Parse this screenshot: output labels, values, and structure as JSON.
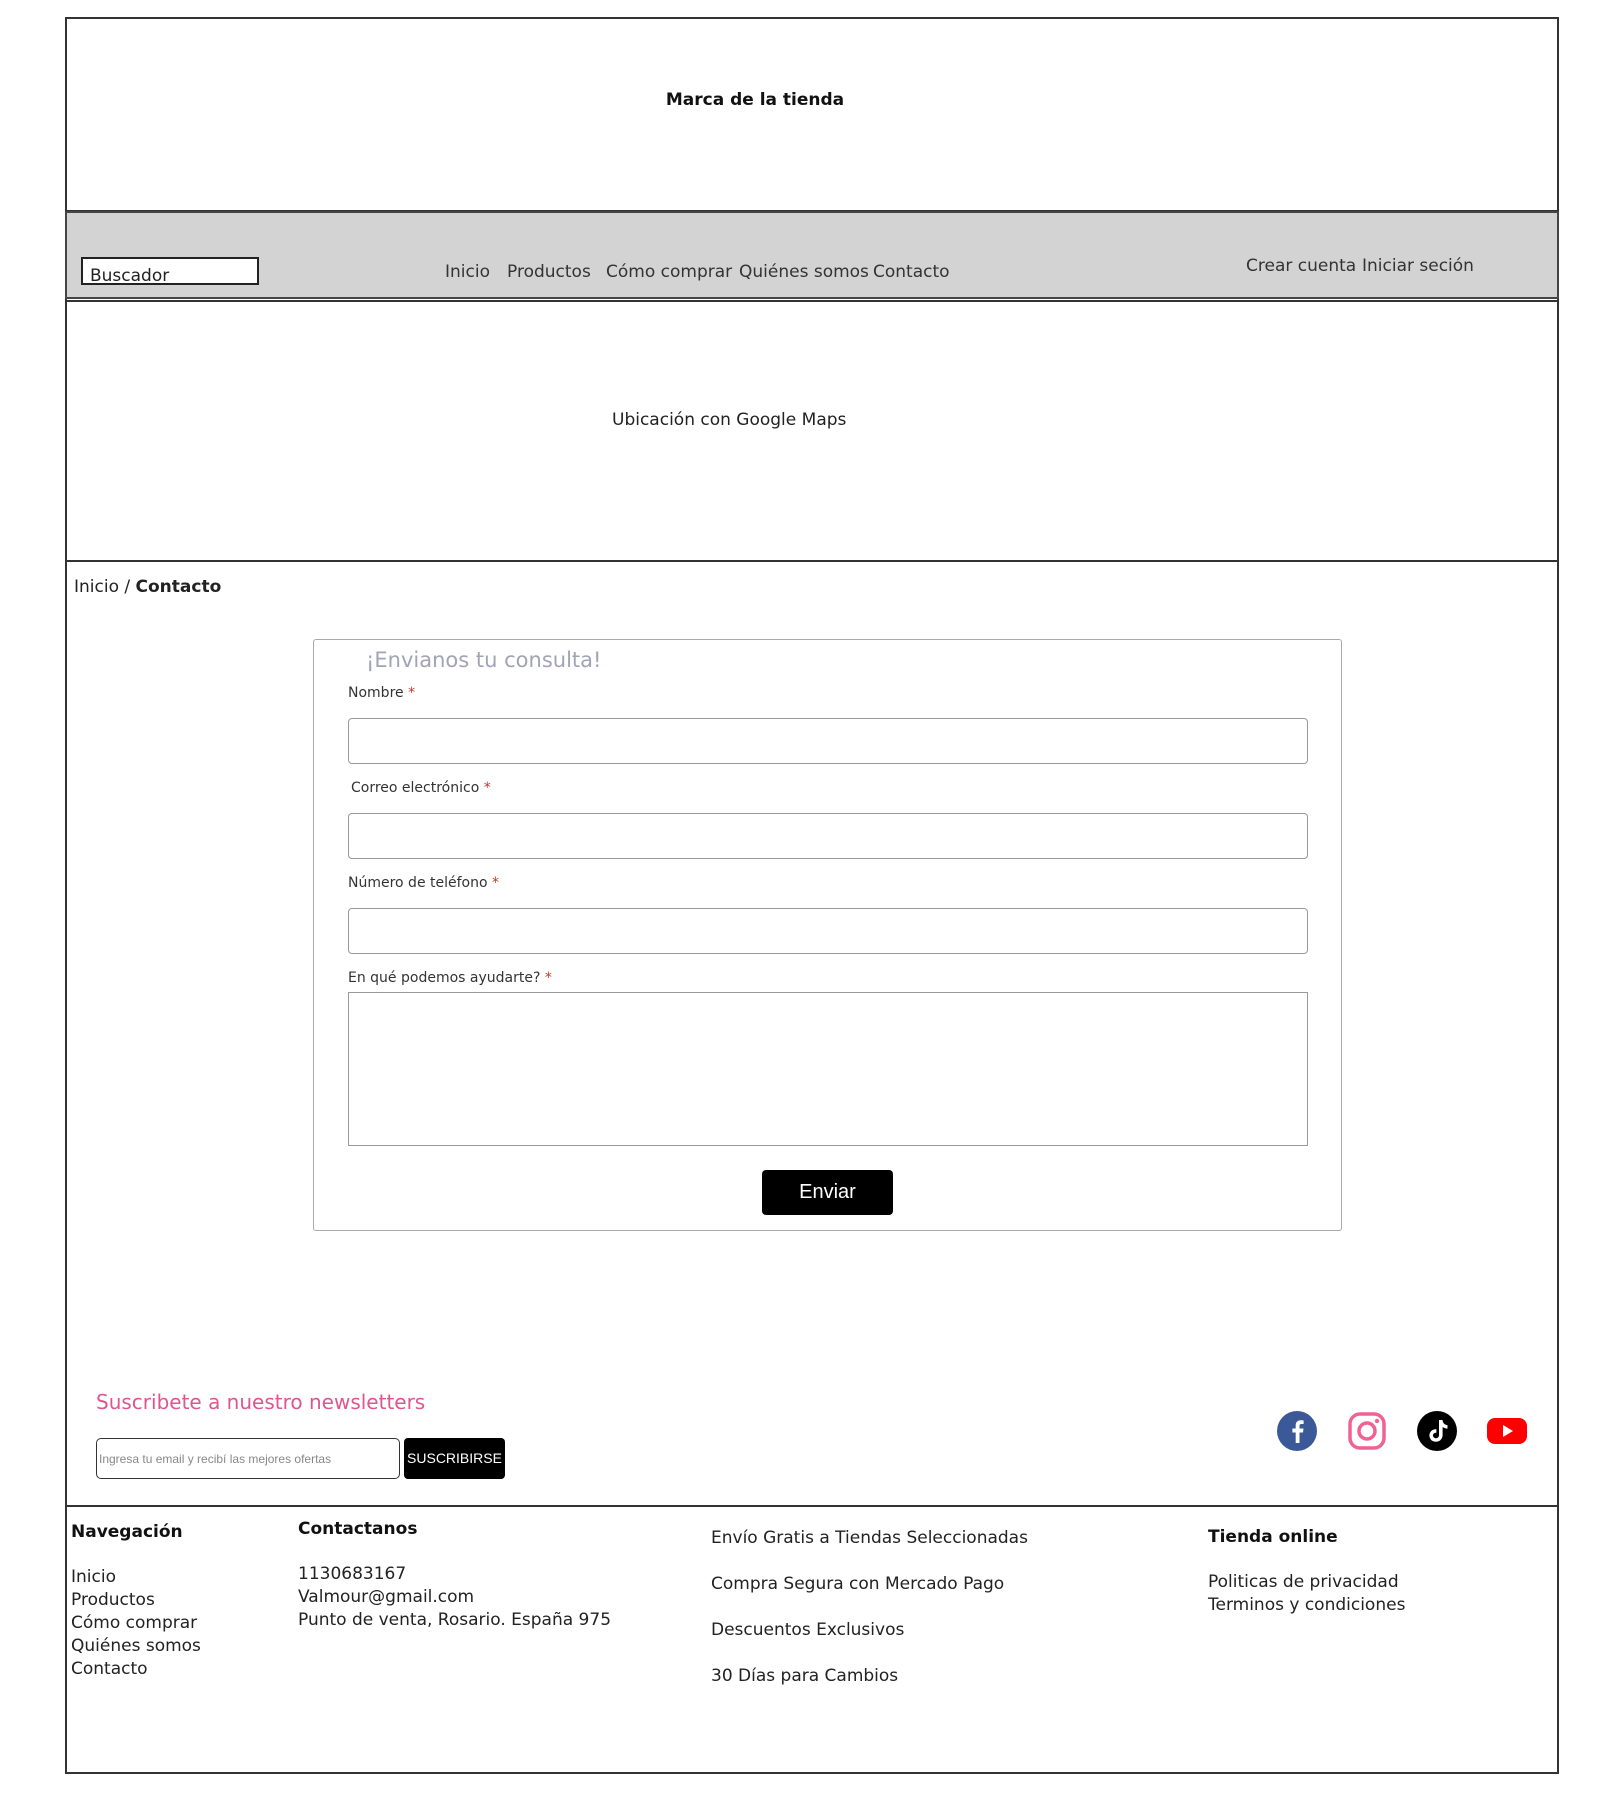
{
  "header": {
    "brand": "Marca de la tienda"
  },
  "navbar": {
    "search_placeholder": "Buscador",
    "links": [
      "Inicio",
      "Productos",
      "Cómo comprar",
      "Quiénes somos",
      "Contacto"
    ],
    "account": [
      "Crear cuenta",
      "Iniciar seción"
    ]
  },
  "map": {
    "label": "Ubicación con Google Maps"
  },
  "breadcrumb": {
    "home": "Inicio",
    "separator": " / ",
    "current": "Contacto"
  },
  "form": {
    "title": "¡Envianos tu consulta!",
    "required_mark": "*",
    "fields": [
      {
        "label": "Nombre",
        "value": ""
      },
      {
        "label": "Correo electrónico",
        "value": ""
      },
      {
        "label": "Número de teléfono",
        "value": ""
      },
      {
        "label": "En qué podemos ayudarte?",
        "value": ""
      }
    ],
    "submit_label": "Enviar"
  },
  "newsletter": {
    "title": "Suscribete a nuestro newsletters",
    "placeholder": "Ingresa tu email y recibí las mejores ofertas",
    "button_label": "SUSCRIBIRSE"
  },
  "social": {
    "icons": [
      "facebook-icon",
      "instagram-icon",
      "tiktok-icon",
      "youtube-icon"
    ],
    "colors": {
      "facebook": "#3b5998",
      "instagram": "#f06292",
      "tiktok": "#000000",
      "youtube": "#ff0000"
    }
  },
  "footer": {
    "navigation": {
      "heading": "Navegación",
      "items": [
        "Inicio",
        "Productos",
        "Cómo comprar",
        "Quiénes somos",
        "Contacto"
      ]
    },
    "contact": {
      "heading": "Contactanos",
      "lines": [
        "1130683167",
        "Valmour@gmail.com",
        "Punto de venta, Rosario. España 975"
      ]
    },
    "benefits": [
      "Envío Gratis a Tiendas Seleccionadas",
      "Compra Segura con Mercado Pago",
      "Descuentos Exclusivos",
      "30 Días para Cambios"
    ],
    "store": {
      "heading": "Tienda online",
      "items": [
        "Politicas de privacidad",
        "Terminos y condiciones"
      ]
    }
  },
  "colors": {
    "navbar_bg": "#d3d3d3",
    "accent_pink": "#e0558f",
    "form_title": "#a3a3b8",
    "button_bg": "#000000"
  }
}
